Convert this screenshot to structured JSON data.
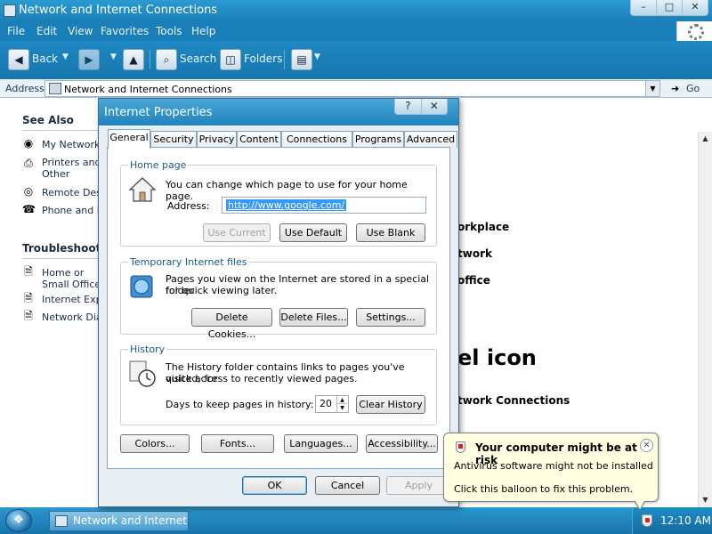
{
  "window": {
    "title": "Network and Internet Connections",
    "controls": [
      "–",
      "□",
      "✕"
    ]
  },
  "menubar": [
    "File",
    "Edit",
    "View",
    "Favorites",
    "Tools",
    "Help"
  ],
  "toolbar": {
    "back": "Back",
    "search": "Search",
    "folders": "Folders"
  },
  "address": {
    "label": "Address",
    "value": "Network and Internet Connections",
    "go": "Go"
  },
  "leftpane": {
    "see_also": {
      "heading": "See Also",
      "items": [
        "My Network Places",
        "Printers and Other Hardware",
        "Remote Desktop",
        "Phone and Modem Options"
      ]
    },
    "troubleshooters": {
      "heading": "Troubleshooters",
      "items": [
        "Home or Small Office Networking",
        "Internet Explorer",
        "Network Diagnostics"
      ]
    }
  },
  "main": {
    "fragments": [
      "orkplace",
      "twork",
      "office",
      "el icon",
      "twork Connections"
    ]
  },
  "taskbar": {
    "task": "Network and Internet ...",
    "clock": "12:10 AM"
  },
  "dialog": {
    "title": "Internet Properties",
    "controls": [
      "?",
      "✕"
    ],
    "tabs": [
      "General",
      "Security",
      "Privacy",
      "Content",
      "Connections",
      "Programs",
      "Advanced"
    ],
    "homepage": {
      "label": "Home page",
      "desc": "You can change which page to use for your home page.",
      "address_label": "Address:",
      "address_value": "http://www.google.com/",
      "use_current": "Use Current",
      "use_default": "Use Default",
      "use_blank": "Use Blank"
    },
    "temp_files": {
      "label": "Temporary Internet files",
      "desc1": "Pages you view on the Internet are stored in a special folder",
      "desc2": "for quick viewing later.",
      "delete_cookies": "Delete Cookies...",
      "delete_files": "Delete Files...",
      "settings": "Settings..."
    },
    "history": {
      "label": "History",
      "desc1": "The History folder contains links to pages you've visited, for",
      "desc2": "quick access to recently viewed pages.",
      "days_label": "Days to keep pages in history:",
      "days_value": "20",
      "clear": "Clear History"
    },
    "bottom_buttons": {
      "colors": "Colors...",
      "fonts": "Fonts...",
      "languages": "Languages...",
      "accessibility": "Accessibility..."
    },
    "ok": "OK",
    "cancel": "Cancel",
    "apply": "Apply"
  },
  "balloon": {
    "title": "Your computer might be at risk",
    "line1": "Antivirus software might not be installed",
    "line2": "Click this balloon to fix this problem."
  }
}
